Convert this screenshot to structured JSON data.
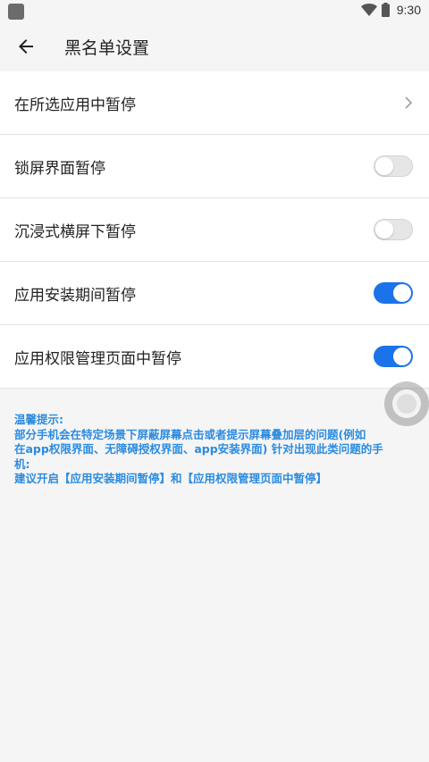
{
  "status_bar": {
    "time": "9:30",
    "icons": [
      "app-notification-icon",
      "wifi-icon",
      "battery-icon"
    ]
  },
  "app_bar": {
    "title": "黑名单设置",
    "back_icon": "arrow-left-icon"
  },
  "settings": {
    "rows": [
      {
        "label": "在所选应用中暂停",
        "control": "chevron"
      },
      {
        "label": "锁屏界面暂停",
        "control": "toggle",
        "checked": false
      },
      {
        "label": "沉浸式横屏下暂停",
        "control": "toggle",
        "checked": false
      },
      {
        "label": "应用安装期间暂停",
        "control": "toggle",
        "checked": true
      },
      {
        "label": "应用权限管理页面中暂停",
        "control": "toggle",
        "checked": true
      }
    ]
  },
  "tips": {
    "heading": "温馨提示:",
    "line1": "部分手机会在特定场景下屏蔽屏幕点击或者提示屏幕叠加层的问题(例如",
    "line2": "在app权限界面、无障碍授权界面、app安装界面) 针对出现此类问题的手",
    "line3": "机:",
    "line4": "建议开启【应用安装期间暂停】和【应用权限管理页面中暂停】"
  },
  "colors": {
    "accent": "#1a73e8",
    "tip_text": "#2b8be0",
    "background": "#f5f5f5"
  }
}
